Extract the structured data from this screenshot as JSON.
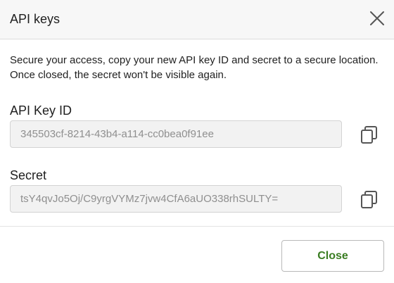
{
  "dialog": {
    "title": "API keys",
    "description": "Secure your access, copy your new API key ID and secret to a secure location. Once closed, the secret won't be visible again."
  },
  "fields": {
    "key_id": {
      "label": "API Key ID",
      "value": "345503cf-8214-43b4-a114-cc0bea0f91ee"
    },
    "secret": {
      "label": "Secret",
      "value": "tsY4qvJo5Oj/C9yrgVYMz7jvw4CfA6aUO338rhSULTY="
    }
  },
  "footer": {
    "close_label": "Close"
  },
  "icons": {
    "close": "close-icon",
    "copy": "copy-icon"
  },
  "colors": {
    "header_bg": "#f7f7f7",
    "input_bg": "#f2f2f2",
    "input_text": "#8f8f8f",
    "close_button_text": "#3a7d22",
    "icon": "#555555"
  }
}
